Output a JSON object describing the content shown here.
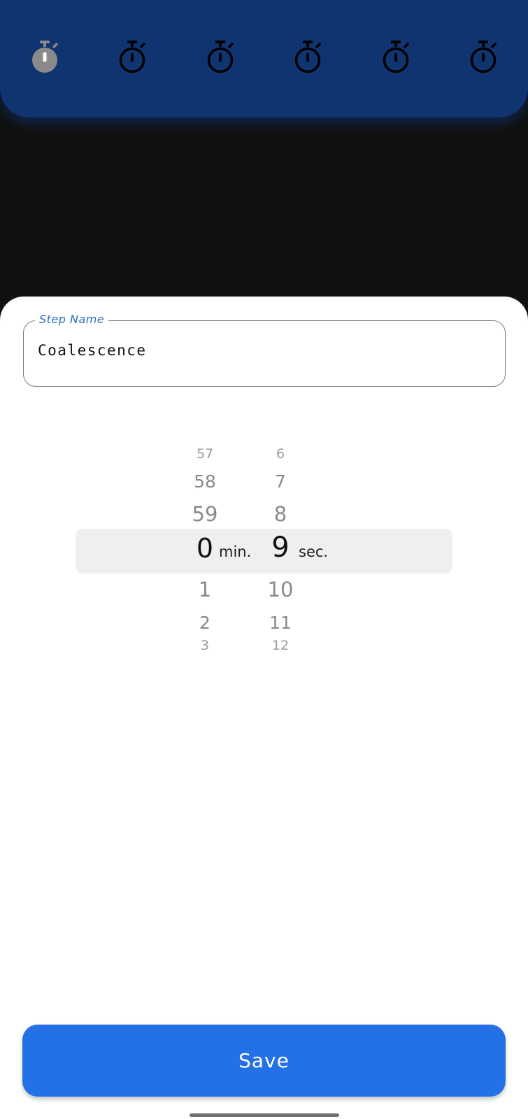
{
  "top_bar": {
    "active_index": 0,
    "icons": [
      {
        "name": "stopwatch-icon",
        "color": "#8a8a8a"
      },
      {
        "name": "stopwatch-icon",
        "color": "#000000"
      },
      {
        "name": "stopwatch-icon",
        "color": "#000000"
      },
      {
        "name": "stopwatch-icon",
        "color": "#000000"
      },
      {
        "name": "stopwatch-icon",
        "color": "#000000"
      },
      {
        "name": "stopwatch-icon",
        "color": "#000000"
      }
    ]
  },
  "step_name": {
    "label": "Step Name",
    "value": "Coalescence"
  },
  "picker": {
    "minutes": {
      "above": [
        "57",
        "58",
        "59"
      ],
      "selected": "0",
      "below": [
        "1",
        "2",
        "3"
      ],
      "unit": "min."
    },
    "seconds": {
      "above": [
        "6",
        "7",
        "8"
      ],
      "selected": "9",
      "below": [
        "10",
        "11",
        "12"
      ],
      "unit": "sec."
    }
  },
  "save_button": {
    "label": "Save",
    "color": "#2470e6"
  },
  "colors": {
    "top_bar": "#0f3470",
    "background": "#111111",
    "field_label": "#2f6fbf"
  }
}
